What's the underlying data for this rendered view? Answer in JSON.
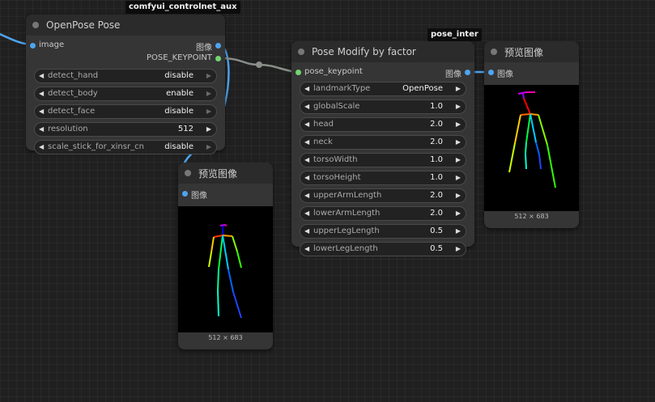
{
  "badges": {
    "aux": "comfyui_controlnet_aux",
    "pose_inter": "pose_inter"
  },
  "openpose_node": {
    "title": "OpenPose Pose",
    "input_image": "image",
    "output_image": "图像",
    "output_keypoint": "POSE_KEYPOINT",
    "widgets": [
      {
        "name": "detect_hand",
        "value": "disable"
      },
      {
        "name": "detect_body",
        "value": "enable"
      },
      {
        "name": "detect_face",
        "value": "disable"
      },
      {
        "name": "resolution",
        "value": "512"
      },
      {
        "name": "scale_stick_for_xinsr_cn",
        "value": "disable"
      }
    ]
  },
  "preview_node_1": {
    "title": "预览图像",
    "input_image": "图像",
    "dims": "512 × 683"
  },
  "modify_node": {
    "title": "Pose Modify by factor",
    "input_keypoint": "pose_keypoint",
    "output_image": "图像",
    "widgets": [
      {
        "name": "landmarkType",
        "value": "OpenPose"
      },
      {
        "name": "globalScale",
        "value": "1.0"
      },
      {
        "name": "head",
        "value": "2.0"
      },
      {
        "name": "neck",
        "value": "2.0"
      },
      {
        "name": "torsoWidth",
        "value": "1.0"
      },
      {
        "name": "torsoHeight",
        "value": "1.0"
      },
      {
        "name": "upperArmLength",
        "value": "2.0"
      },
      {
        "name": "lowerArmLength",
        "value": "2.0"
      },
      {
        "name": "upperLegLength",
        "value": "0.5"
      },
      {
        "name": "lowerLegLength",
        "value": "0.5"
      }
    ]
  },
  "preview_node_2": {
    "title": "预览图像",
    "input_image": "图像",
    "dims": "512 × 683"
  },
  "colors": {
    "image_port": "#4ea4f0",
    "keypoint_port": "#72d572",
    "image_wire": "#4ea4f0",
    "keypoint_wire": "#8a8f8a"
  },
  "icons": {
    "decrement": "triangle-left-icon",
    "increment": "triangle-right-icon",
    "node_status": "circle-dot-icon"
  }
}
